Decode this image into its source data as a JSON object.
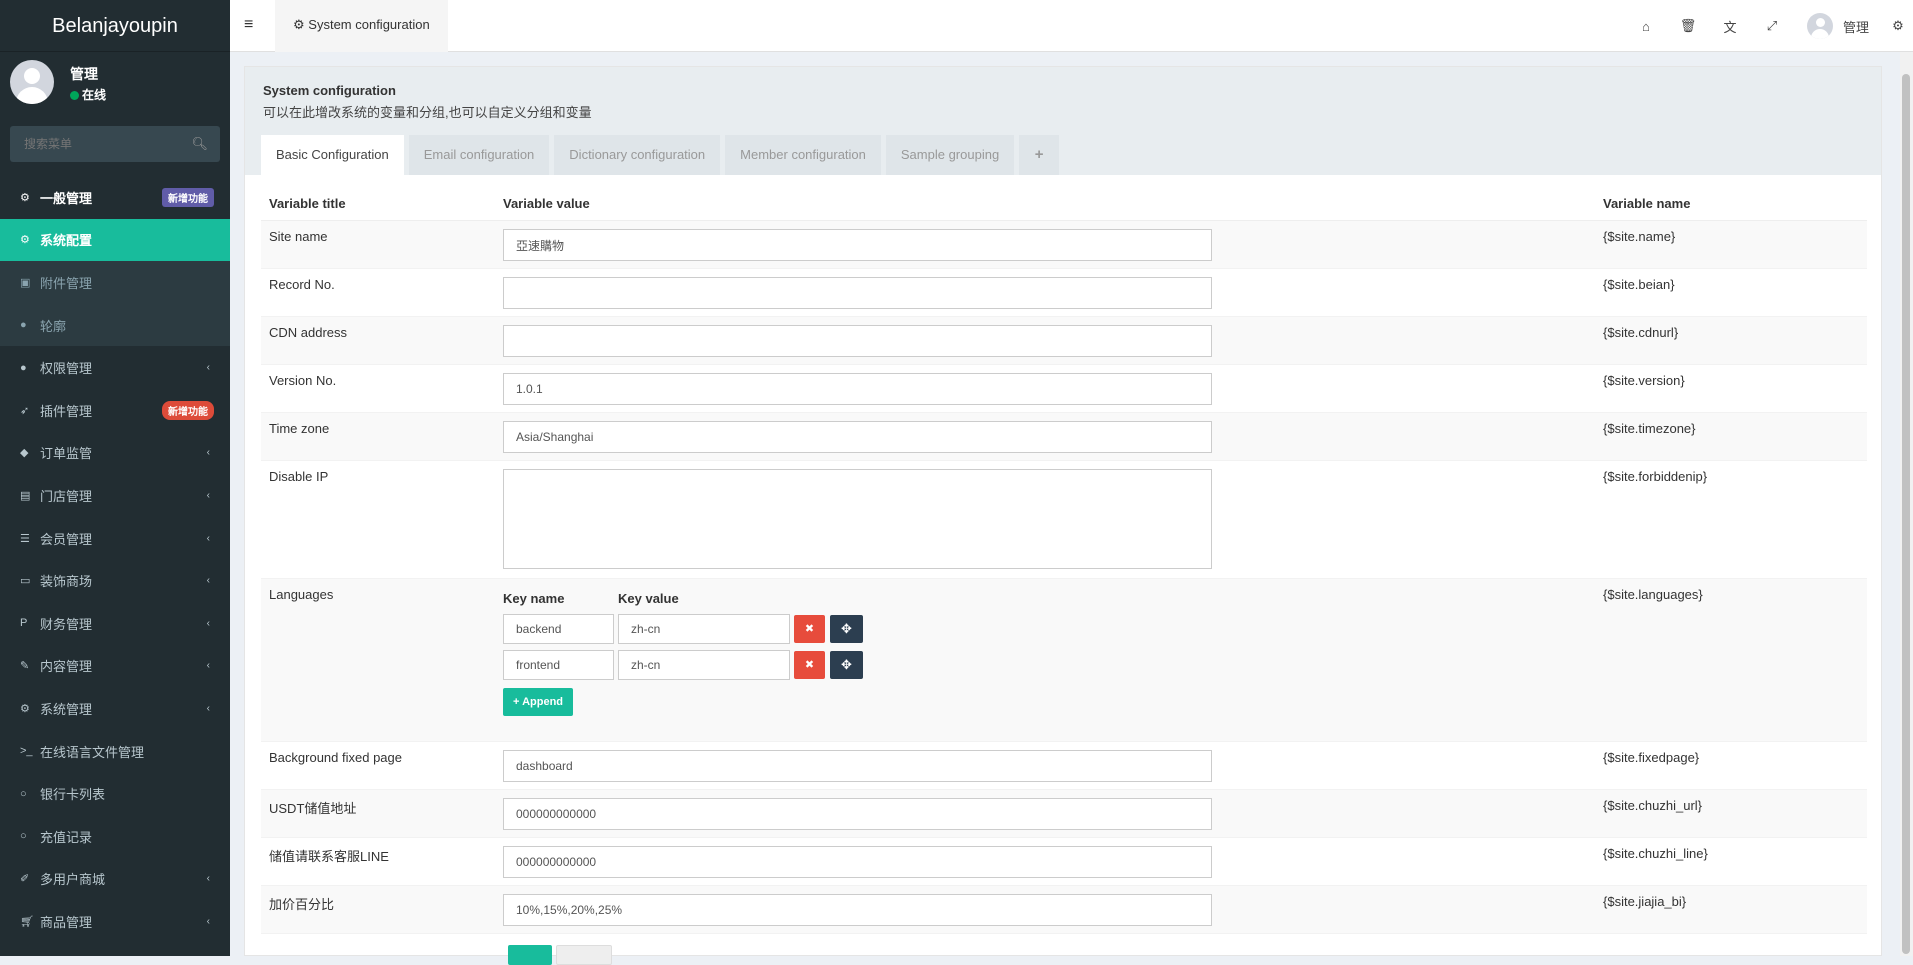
{
  "sidebar": {
    "brand": "Belanjayoupin",
    "user": {
      "name": "管理",
      "status": "在线"
    },
    "search_placeholder": "搜索菜单",
    "items": [
      {
        "label": "一般管理",
        "icon": "cogs-icon",
        "badge": "新增功能"
      },
      {
        "label": "系统配置",
        "icon": "gear-icon"
      },
      {
        "label": "附件管理",
        "icon": "file-image-icon"
      },
      {
        "label": "轮廓",
        "icon": "user-icon"
      },
      {
        "label": "权限管理",
        "icon": "group-icon"
      },
      {
        "label": "插件管理",
        "icon": "rocket-icon",
        "badge": "新增功能"
      },
      {
        "label": "订单监管",
        "icon": "cube-icon"
      },
      {
        "label": "门店管理",
        "icon": "archive-icon"
      },
      {
        "label": "会员管理",
        "icon": "list-icon"
      },
      {
        "label": "装饰商场",
        "icon": "desktop-icon"
      },
      {
        "label": "财务管理",
        "icon": "paypal-icon"
      },
      {
        "label": "内容管理",
        "icon": "edit-icon"
      },
      {
        "label": "系统管理",
        "icon": "gear-icon"
      },
      {
        "label": "在线语言文件管理",
        "icon": "terminal-icon"
      },
      {
        "label": "银行卡列表",
        "icon": "circle-icon"
      },
      {
        "label": "充值记录",
        "icon": "circle-icon"
      },
      {
        "label": "多用户商城",
        "icon": "magic-icon"
      },
      {
        "label": "商品管理",
        "icon": "cart-icon"
      }
    ]
  },
  "topbar": {
    "tab_label": "System configuration",
    "user_name": "管理",
    "icons": [
      "home-icon",
      "trash-icon",
      "translate-icon",
      "fullscreen-icon",
      "cogs-icon"
    ]
  },
  "panel": {
    "title": "System configuration",
    "subtitle": "可以在此增改系统的变量和分组,也可以自定义分组和变量",
    "tabs": [
      "Basic Configuration",
      "Email configuration",
      "Dictionary configuration",
      "Member configuration",
      "Sample grouping",
      "+"
    ]
  },
  "table": {
    "headers": {
      "title": "Variable title",
      "value": "Variable value",
      "name": "Variable name"
    },
    "rows": [
      {
        "title": "Site name",
        "value": "亞速購物",
        "name": "{$site.name}"
      },
      {
        "title": "Record No.",
        "value": "",
        "name": "{$site.beian}"
      },
      {
        "title": "CDN address",
        "value": "",
        "name": "{$site.cdnurl}"
      },
      {
        "title": "Version No.",
        "value": "1.0.1",
        "name": "{$site.version}"
      },
      {
        "title": "Time zone",
        "value": "Asia/Shanghai",
        "name": "{$site.timezone}"
      },
      {
        "title": "Disable IP",
        "value": "",
        "name": "{$site.forbiddenip}"
      },
      {
        "title": "Languages",
        "name": "{$site.languages}"
      },
      {
        "title": "Background fixed page",
        "value": "dashboard",
        "name": "{$site.fixedpage}"
      },
      {
        "title": "USDT储值地址",
        "value": "000000000000",
        "name": "{$site.chuzhi_url}"
      },
      {
        "title": "储值请联系客服LINE",
        "value": "000000000000",
        "name": "{$site.chuzhi_line}"
      },
      {
        "title": "加价百分比",
        "value": "10%,15%,20%,25%",
        "name": "{$site.jiajia_bi}"
      }
    ],
    "languages": {
      "key_header": "Key name",
      "value_header": "Key value",
      "pairs": [
        {
          "key": "backend",
          "value": "zh-cn"
        },
        {
          "key": "frontend",
          "value": "zh-cn"
        }
      ],
      "append_label": "+ Append"
    }
  }
}
